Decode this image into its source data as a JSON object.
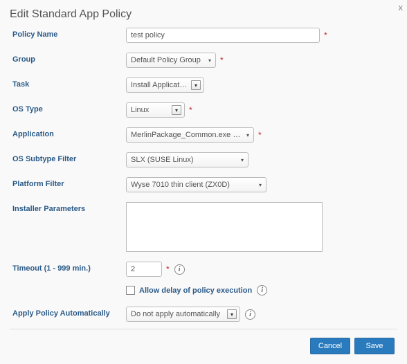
{
  "dialog": {
    "title": "Edit Standard App Policy",
    "close_label": "x"
  },
  "fields": {
    "policy_name": {
      "label": "Policy Name",
      "value": "test policy",
      "required": true
    },
    "group": {
      "label": "Group",
      "value": "Default Policy Group",
      "required": true
    },
    "task": {
      "label": "Task",
      "value": "Install Application",
      "required": false
    },
    "os_type": {
      "label": "OS Type",
      "value": "Linux",
      "required": true
    },
    "application": {
      "label": "Application",
      "value": "MerlinPackage_Common.exe (Loc",
      "required": true
    },
    "os_subtype_filter": {
      "label": "OS Subtype Filter",
      "value": "SLX (SUSE Linux)",
      "required": false
    },
    "platform_filter": {
      "label": "Platform Filter",
      "value": "Wyse 7010 thin client (ZX0D)",
      "required": false
    },
    "installer_params": {
      "label": "Installer Parameters",
      "value": ""
    },
    "timeout": {
      "label": "Timeout (1 - 999 min.)",
      "value": "2",
      "required": true
    },
    "allow_delay": {
      "label": "Allow delay of policy execution",
      "checked": false
    },
    "apply_auto": {
      "label": "Apply Policy Automatically",
      "value": "Do not apply automatically"
    }
  },
  "footer": {
    "cancel": "Cancel",
    "save": "Save"
  },
  "glyphs": {
    "required": "*",
    "info": "i",
    "down": "▾",
    "double_down": "▾"
  }
}
